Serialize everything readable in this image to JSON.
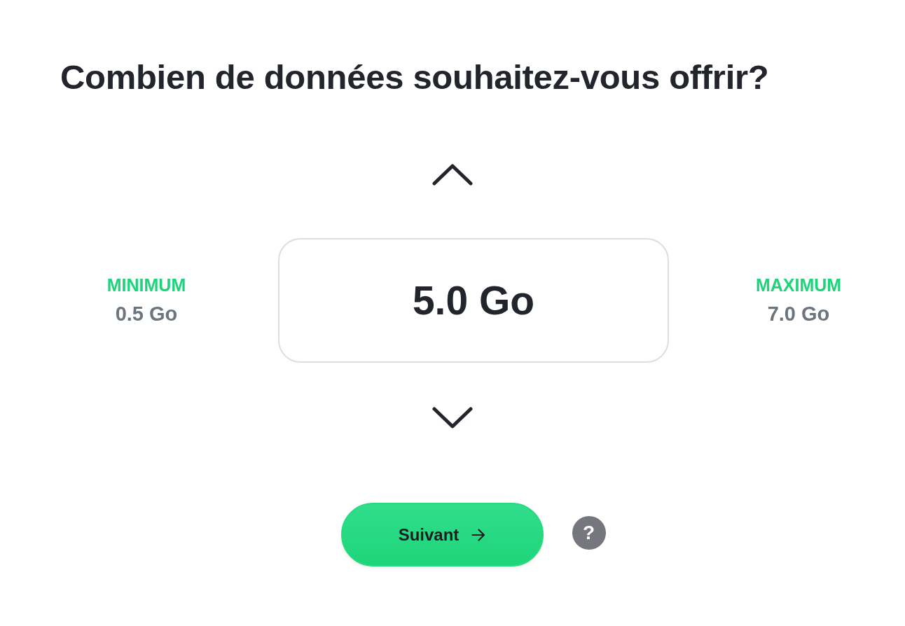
{
  "title": "Combien de données souhaitez-vous offrir?",
  "stepper": {
    "value": "5.0 Go",
    "minimum": {
      "label": "MINIMUM",
      "value": "0.5 Go"
    },
    "maximum": {
      "label": "MAXIMUM",
      "value": "7.0 Go"
    }
  },
  "next_button": {
    "label": "Suivant"
  },
  "help_button": {
    "label": "?"
  }
}
